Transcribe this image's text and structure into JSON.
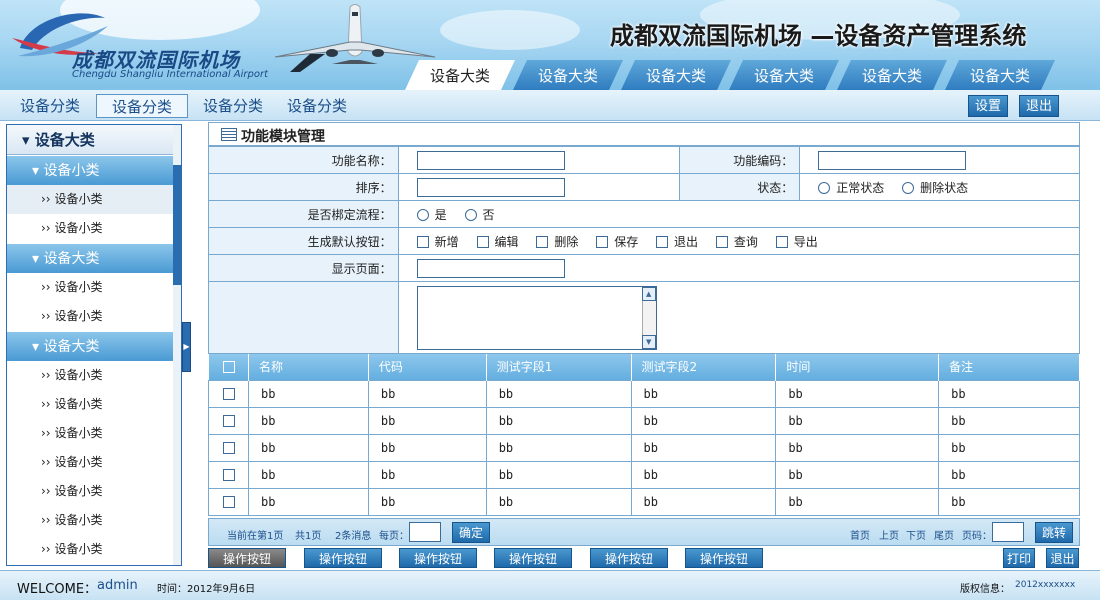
{
  "header": {
    "logo_cn": "成都双流国际机场",
    "logo_en": "Chengdu Shangliu International Airport",
    "system_title": "成都双流国际机场 —设备资产管理系统",
    "tabs": [
      "设备大类",
      "设备大类",
      "设备大类",
      "设备大类",
      "设备大类",
      "设备大类"
    ],
    "active_tab": 0
  },
  "subnav": {
    "items": [
      "设备分类",
      "设备分类",
      "设备分类",
      "设备分类"
    ],
    "active": 1,
    "settings_label": "设置",
    "logout_label": "退出"
  },
  "sidebar": {
    "title": "▾ 设备大类",
    "groups": [
      {
        "label": "▾ 设备小类",
        "items": [
          "设备小类",
          "设备小类"
        ]
      },
      {
        "label": "▾ 设备大类",
        "items": [
          "设备小类",
          "设备小类"
        ]
      },
      {
        "label": "▾ 设备大类",
        "items": [
          "设备小类",
          "设备小类",
          "设备小类",
          "设备小类",
          "设备小类",
          "设备小类",
          "设备小类"
        ]
      }
    ],
    "item_prefix": "››",
    "selected_item": "0.0"
  },
  "panel": {
    "title": "功能模块管理",
    "form": {
      "function_name_label": "功能名称：",
      "function_code_label": "功能编码：",
      "order_label": "排序：",
      "status_label": "状态：",
      "status_options": [
        "正常状态",
        "删除状态"
      ],
      "bind_flow_label": "是否梆定流程：",
      "bind_flow_options": [
        "是",
        "否"
      ],
      "default_buttons_label": "生成默认按钮：",
      "default_buttons": [
        "新增",
        "编辑",
        "删除",
        "保存",
        "退出",
        "查询",
        "导出"
      ],
      "display_page_label": "显示页面："
    },
    "table": {
      "columns": [
        "名称",
        "代码",
        "测试字段1",
        "测试字段2",
        "时间",
        "备注"
      ],
      "rows": [
        [
          "bb",
          "bb",
          "bb",
          "bb",
          "bb",
          "bb"
        ],
        [
          "bb",
          "bb",
          "bb",
          "bb",
          "bb",
          "bb"
        ],
        [
          "bb",
          "bb",
          "bb",
          "bb",
          "bb",
          "bb"
        ],
        [
          "bb",
          "bb",
          "bb",
          "bb",
          "bb",
          "bb"
        ],
        [
          "bb",
          "bb",
          "bb",
          "bb",
          "bb",
          "bb"
        ]
      ]
    },
    "pager": {
      "current_page": "当前在第1页",
      "total_pages": "共1页",
      "records": "2条消息",
      "per_page": "每页：",
      "confirm": "确定",
      "first": "首页",
      "prev": "上页",
      "next": "下页",
      "last": "尾页",
      "page_no": "页码：",
      "jump": "跳转"
    }
  },
  "actions": {
    "buttons": [
      "操作按钮",
      "操作按钮",
      "操作按钮",
      "操作按钮",
      "操作按钮",
      "操作按钮"
    ],
    "print": "打印",
    "exit": "退出"
  },
  "footer": {
    "welcome": "WELCOME：",
    "user": "admin",
    "time": "时间：2012年9月6日",
    "copyright_label": "版权信息：",
    "copyright_value": "2012xxxxxxx"
  }
}
